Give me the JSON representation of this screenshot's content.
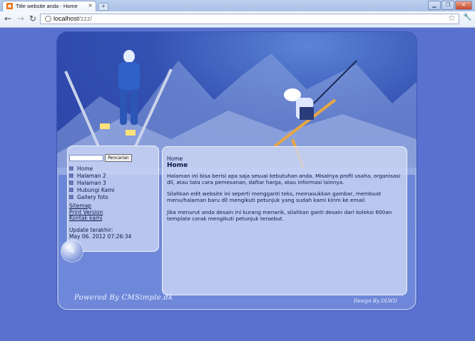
{
  "browser": {
    "tab_title": "Title website anda - Home",
    "tab_close": "×",
    "new_tab": "+",
    "url_host": "localhost",
    "url_path": "/zzz/",
    "back": "←",
    "forward": "→",
    "reload": "↻",
    "bookmark": "☆",
    "menu": "🔧",
    "win_minimize": "▁",
    "win_restore": "❐",
    "win_close": "✕"
  },
  "sidebar": {
    "search_button": "Pencarian",
    "menu": [
      "Home",
      "Halaman 2",
      "Halaman 3",
      "Hubungi Kami",
      "Gallery foto"
    ],
    "links": [
      "Sitemap",
      "Print Version",
      "Kontak kami"
    ],
    "update_label": "Update terakhir:",
    "update_value": "May 06. 2012 07:26:34"
  },
  "content": {
    "breadcrumb": "Home",
    "title": "Home",
    "paragraphs": [
      "Halaman ini bisa berisi apa saja sesuai kebutuhan anda. Misalnya profil usaha, organisasi dll, atau tata cara pemesanan, daftar harga, atau informasi lainnya.",
      "Silahkan edit website ini seperti mengganti teks, memasukkan gambar, membuat menu/halaman baru dll mengikuti petunjuk yang sudah kami kirim ke email.",
      "Jika menurut anda desain ini kurang menarik, silahkan ganti desain dari koleksi 600an template corak mengikuti petunjuk tersebut."
    ]
  },
  "footer": {
    "powered": "Powered By CMSimple.dk",
    "design": "Design By DLWD"
  },
  "colors": {
    "page_bg": "#5a72cf",
    "panel": "#cdd7f5"
  }
}
